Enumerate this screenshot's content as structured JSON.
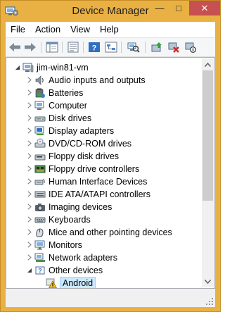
{
  "window": {
    "title": "Device Manager",
    "controls": {
      "minimize": "—",
      "maximize": "□",
      "close": "✕"
    }
  },
  "menu": [
    {
      "label": "File"
    },
    {
      "label": "Action"
    },
    {
      "label": "View"
    },
    {
      "label": "Help"
    }
  ],
  "toolbar": {
    "buttons": [
      "back-icon",
      "forward-icon",
      "console-tree-icon",
      "properties-icon",
      "help-icon",
      "devices-by-connection-icon",
      "scan-hardware-icon",
      "update-driver-icon",
      "uninstall-icon",
      "disable-device-icon"
    ]
  },
  "tree": {
    "root": {
      "label": "jim-win81-vm",
      "expanded": true
    },
    "categories": [
      {
        "label": "Audio inputs and outputs",
        "icon": "speaker-icon",
        "expanded": false
      },
      {
        "label": "Batteries",
        "icon": "battery-icon",
        "expanded": false
      },
      {
        "label": "Computer",
        "icon": "computer-icon",
        "expanded": false
      },
      {
        "label": "Disk drives",
        "icon": "disk-drive-icon",
        "expanded": false
      },
      {
        "label": "Display adapters",
        "icon": "display-adapter-icon",
        "expanded": false
      },
      {
        "label": "DVD/CD-ROM drives",
        "icon": "dvd-drive-icon",
        "expanded": false
      },
      {
        "label": "Floppy disk drives",
        "icon": "floppy-disk-icon",
        "expanded": false
      },
      {
        "label": "Floppy drive controllers",
        "icon": "floppy-controller-icon",
        "expanded": false
      },
      {
        "label": "Human Interface Devices",
        "icon": "hid-icon",
        "expanded": false
      },
      {
        "label": "IDE ATA/ATAPI controllers",
        "icon": "ide-controller-icon",
        "expanded": false
      },
      {
        "label": "Imaging devices",
        "icon": "camera-icon",
        "expanded": false
      },
      {
        "label": "Keyboards",
        "icon": "keyboard-icon",
        "expanded": false
      },
      {
        "label": "Mice and other pointing devices",
        "icon": "mouse-icon",
        "expanded": false
      },
      {
        "label": "Monitors",
        "icon": "monitor-icon",
        "expanded": false
      },
      {
        "label": "Network adapters",
        "icon": "network-adapter-icon",
        "expanded": false
      },
      {
        "label": "Other devices",
        "icon": "other-devices-icon",
        "expanded": true
      }
    ],
    "children": [
      {
        "label": "Android",
        "icon": "warning-device-icon",
        "selected": true,
        "status": "warning"
      }
    ]
  },
  "colors": {
    "frame": "#E9B143",
    "selection_bg": "#CCE8FF",
    "selection_border": "#99D1FF",
    "close_button": "#C75050"
  }
}
